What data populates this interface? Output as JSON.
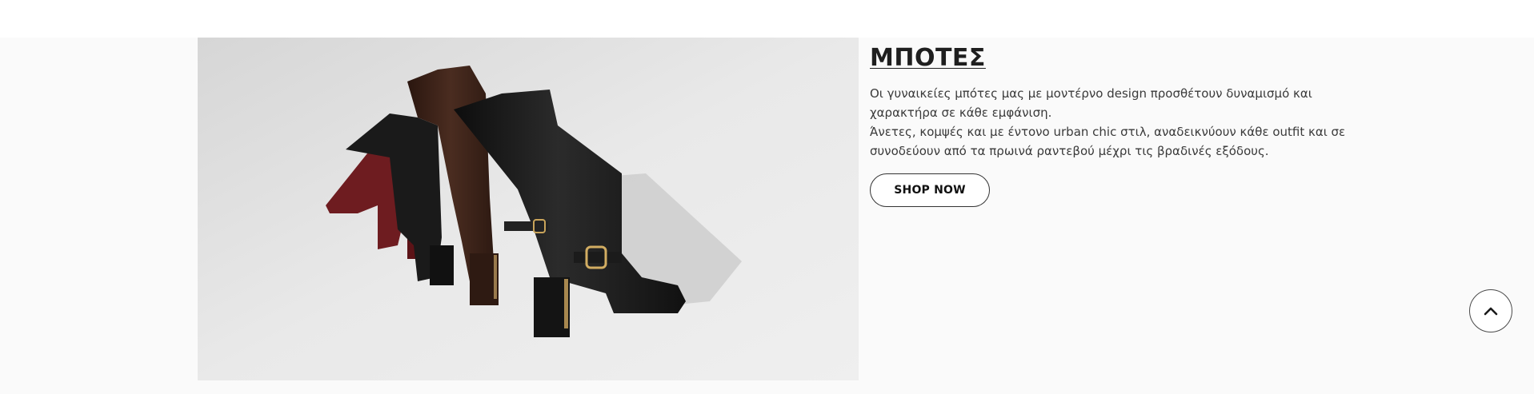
{
  "promo": {
    "title": "ΜΠΟΤΕΣ",
    "line1": "Οι γυναικείες μπότες μας με μοντέρνο design προσθέτουν δυναμισμό και χαρακτήρα σε κάθε εμφάνιση.",
    "line2": "Άνετες, κομψές και με έντονο urban chic στιλ, αναδεικνύουν κάθε outfit και σε συνοδεύουν από τα πρωινά ραντεβού μέχρι τις βραδινές εξόδους.",
    "button_label": "SHOP NOW"
  },
  "icons": {
    "scroll_top": "chevron-up-icon"
  },
  "colors": {
    "background": "#fafafa",
    "text": "#1f1f1f",
    "boot_burgundy": "#7a1f24",
    "boot_red": "#8e1c22",
    "boot_brown": "#3b2219",
    "boot_black": "#151515"
  }
}
